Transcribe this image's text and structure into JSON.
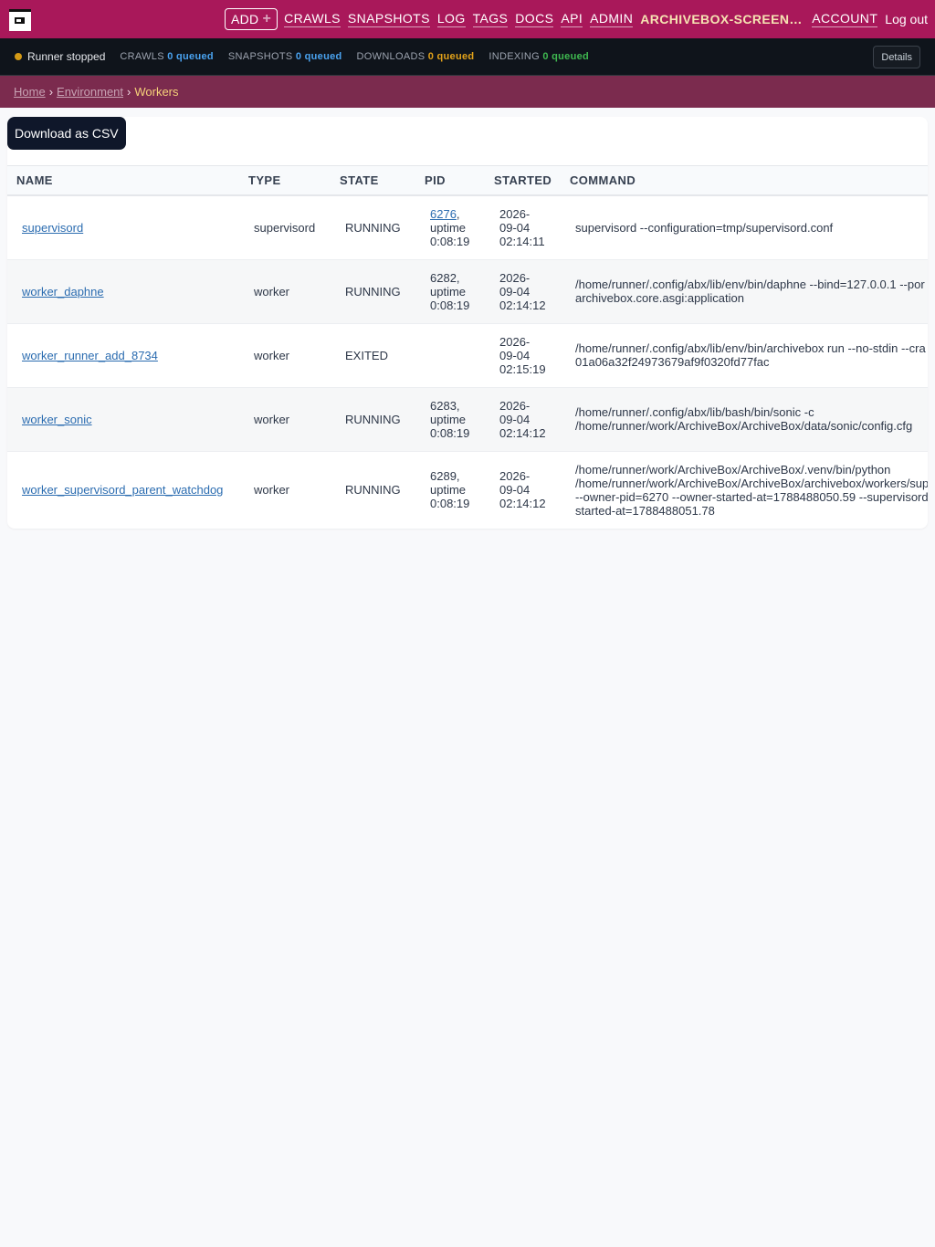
{
  "nav": {
    "add_label": "ADD",
    "links": [
      "CRAWLS",
      "SNAPSHOTS",
      "LOG",
      "TAGS",
      "DOCS",
      "API",
      "ADMIN"
    ],
    "user_label": "ARCHIVEBOX-SCREENS...",
    "account_label": "ACCOUNT",
    "logout_label": "Log out"
  },
  "status": {
    "runner": "Runner stopped",
    "crawls_label": "CRAWLS",
    "crawls_value": "0 queued",
    "snapshots_label": "SNAPSHOTS",
    "snapshots_value": "0 queued",
    "downloads_label": "DOWNLOADS",
    "downloads_value": "0 queued",
    "indexing_label": "INDEXING",
    "indexing_value": "0 queued",
    "details_label": "Details",
    "colors": {
      "runner_dot": "#d49a16",
      "blue": "#4aa3f0",
      "orange": "#e2a21a",
      "green": "#3fb950"
    }
  },
  "breadcrumb": {
    "home": "Home",
    "environment": "Environment",
    "current": "Workers"
  },
  "content": {
    "csv_button": "Download as CSV"
  },
  "table": {
    "headers": {
      "name": "NAME",
      "type": "TYPE",
      "state": "STATE",
      "pid": "PID",
      "started": "STARTED",
      "command": "COMMAND"
    },
    "rows": [
      {
        "name": "supervisord",
        "type": "supervisord",
        "state": "RUNNING",
        "pid": "6276",
        "pid_suffix": ",",
        "uptime1": "uptime",
        "uptime2": "0:08:19",
        "started1": "2026-",
        "started2": "09-04",
        "started3": "02:14:11",
        "cmd1": "supervisord --configuration=tmp/supervisord.conf",
        "cmd2": "",
        "cmd3": "",
        "cmd4": ""
      },
      {
        "name": "worker_daphne",
        "type": "worker",
        "state": "RUNNING",
        "pid": "",
        "pid_suffix": "6282,",
        "uptime1": "uptime",
        "uptime2": "0:08:19",
        "started1": "2026-",
        "started2": "09-04",
        "started3": "02:14:12",
        "cmd1": "/home/runner/.config/abx/lib/env/bin/daphne --bind=127.0.0.1 --por",
        "cmd2": "archivebox.core.asgi:application",
        "cmd3": "",
        "cmd4": ""
      },
      {
        "name": "worker_runner_add_8734",
        "type": "worker",
        "state": "EXITED",
        "pid": "",
        "pid_suffix": "",
        "uptime1": "",
        "uptime2": "",
        "started1": "2026-",
        "started2": "09-04",
        "started3": "02:15:19",
        "cmd1": "/home/runner/.config/abx/lib/env/bin/archivebox run --no-stdin --cra",
        "cmd2": "01a06a32f24973679af9f0320fd77fac",
        "cmd3": "",
        "cmd4": ""
      },
      {
        "name": "worker_sonic",
        "type": "worker",
        "state": "RUNNING",
        "pid": "",
        "pid_suffix": "6283,",
        "uptime1": "uptime",
        "uptime2": "0:08:19",
        "started1": "2026-",
        "started2": "09-04",
        "started3": "02:14:12",
        "cmd1": "/home/runner/.config/abx/lib/bash/bin/sonic -c",
        "cmd2": "/home/runner/work/ArchiveBox/ArchiveBox/data/sonic/config.cfg",
        "cmd3": "",
        "cmd4": ""
      },
      {
        "name": "worker_supervisord_parent_watchdog",
        "type": "worker",
        "state": "RUNNING",
        "pid": "",
        "pid_suffix": "6289,",
        "uptime1": "uptime",
        "uptime2": "0:08:19",
        "started1": "2026-",
        "started2": "09-04",
        "started3": "02:14:12",
        "cmd1": "/home/runner/work/ArchiveBox/ArchiveBox/.venv/bin/python",
        "cmd2": "/home/runner/work/ArchiveBox/ArchiveBox/archivebox/workers/sup",
        "cmd3": "--owner-pid=6270 --owner-started-at=1788488050.59 --supervisord",
        "cmd4": "started-at=1788488051.78"
      }
    ]
  }
}
